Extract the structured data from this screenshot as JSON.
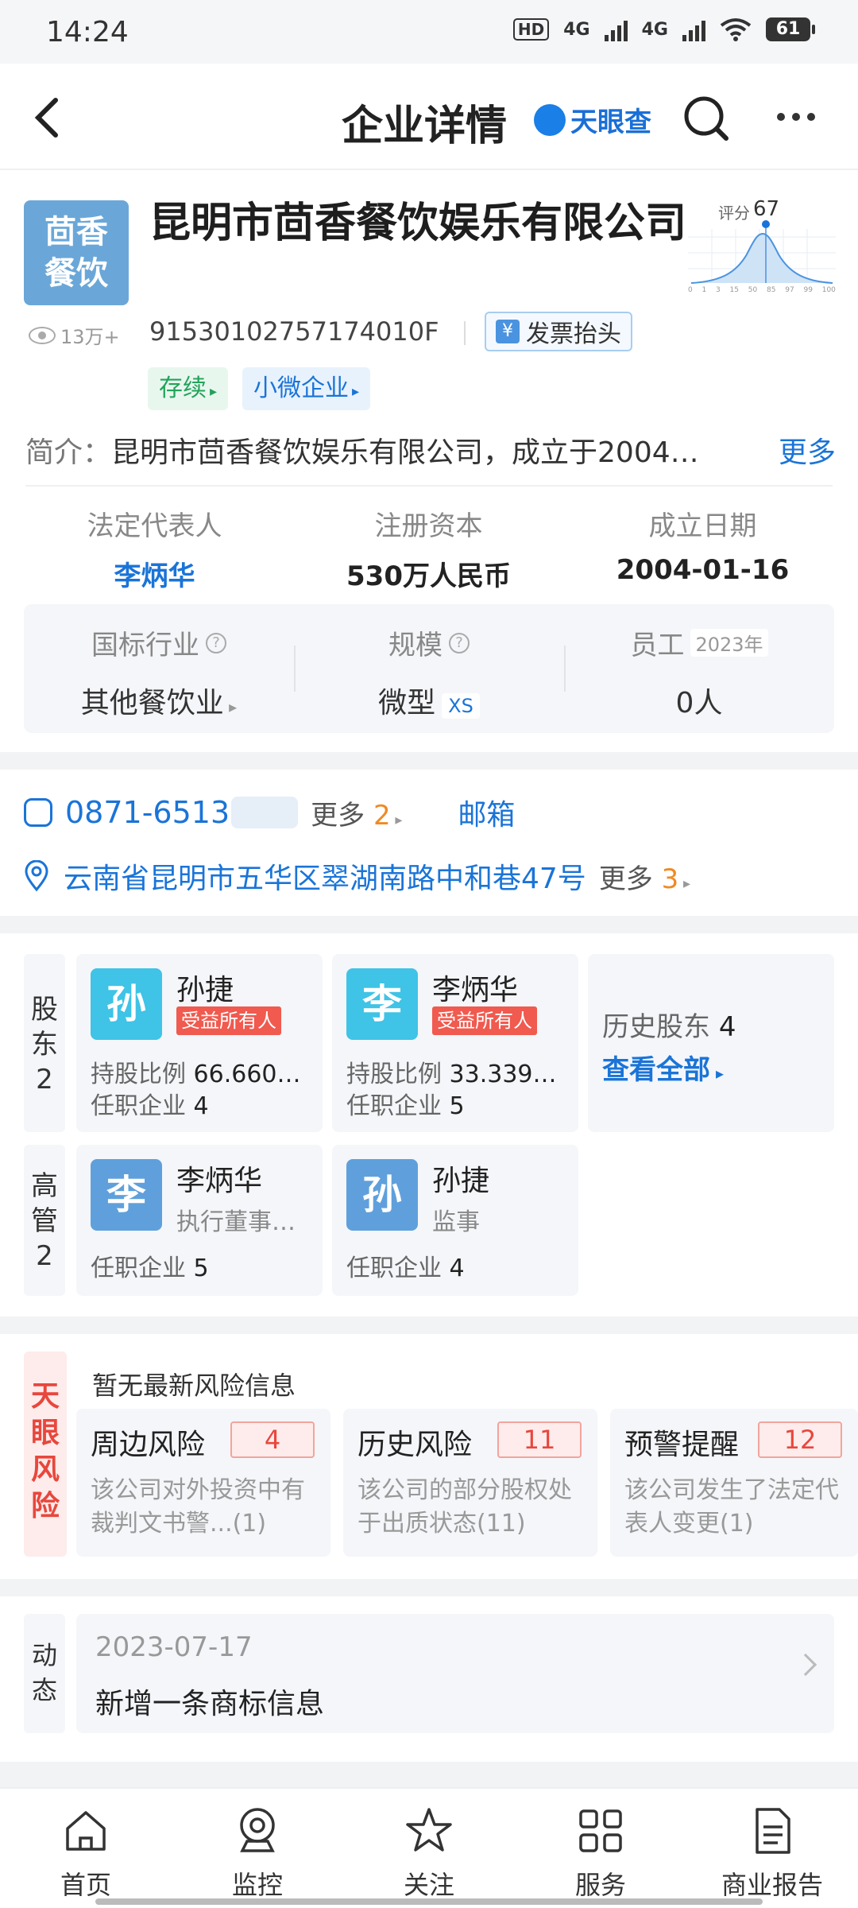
{
  "status_bar": {
    "time": "14:24",
    "hd": "HD",
    "net1": "4G",
    "net2": "4G",
    "battery": "61"
  },
  "nav": {
    "title": "企业详情",
    "brand": "天眼查"
  },
  "company": {
    "logo_line1": "茴香",
    "logo_line2": "餐饮",
    "name": "昆明市茴香餐饮娱乐有限公司",
    "score_label": "评分",
    "score_value": "67",
    "score_ticks": [
      "0",
      "1",
      "3",
      "15",
      "50",
      "85",
      "97",
      "99",
      "100"
    ],
    "views": "13万+",
    "credit_code": "91530102757174010F",
    "invoice_label": "发票抬头",
    "tags": [
      "存续",
      "小微企业"
    ],
    "intro_label": "简介：",
    "intro_text": "昆明市茴香餐饮娱乐有限公司，成立于2004…",
    "intro_more": "更多"
  },
  "key_info": [
    {
      "label": "法定代表人",
      "value": "李炳华"
    },
    {
      "label": "注册资本",
      "value": "530万人民币"
    },
    {
      "label": "成立日期",
      "value": "2004-01-16"
    }
  ],
  "industry_box": {
    "industry_label": "国标行业",
    "industry_value": "其他餐饮业",
    "scale_label": "规模",
    "scale_value": "微型",
    "scale_badge": "XS",
    "staff_label": "员工",
    "staff_year": "2023年",
    "staff_value": "0人"
  },
  "contact": {
    "phone": "0871-6513",
    "phone_more_label": "更多",
    "phone_more_count": "2",
    "email_label": "邮箱",
    "address": "云南省昆明市五华区翠湖南路中和巷47号",
    "address_more_label": "更多",
    "address_more_count": "3"
  },
  "shareholders": {
    "label_chars": [
      "股",
      "东",
      "2"
    ],
    "items": [
      {
        "avatar": "孙",
        "name": "孙捷",
        "badge": "受益所有人",
        "ratio_label": "持股比例",
        "ratio": "66.660…",
        "jobs_label": "任职企业",
        "jobs": "4"
      },
      {
        "avatar": "李",
        "name": "李炳华",
        "badge": "受益所有人",
        "ratio_label": "持股比例",
        "ratio": "33.339…",
        "jobs_label": "任职企业",
        "jobs": "5"
      }
    ],
    "history_label": "历史股东",
    "history_count": "4",
    "view_all": "查看全部"
  },
  "executives": {
    "label_chars": [
      "高",
      "管",
      "2"
    ],
    "items": [
      {
        "avatar": "李",
        "name": "李炳华",
        "role": "执行董事…",
        "jobs_label": "任职企业",
        "jobs": "5"
      },
      {
        "avatar": "孙",
        "name": "孙捷",
        "role": "监事",
        "jobs_label": "任职企业",
        "jobs": "4"
      }
    ]
  },
  "risk": {
    "label_chars": [
      "天",
      "眼",
      "风",
      "险"
    ],
    "none_text": "暂无最新风险信息",
    "items": [
      {
        "title": "周边风险",
        "count": "4",
        "desc": "该公司对外投资中有裁判文书警...(1)"
      },
      {
        "title": "历史风险",
        "count": "11",
        "desc": "该公司的部分股权处于出质状态(11)"
      },
      {
        "title": "预警提醒",
        "count": "12",
        "desc": "该公司发生了法定代表人变更(1)"
      }
    ]
  },
  "news": {
    "label_chars": [
      "动",
      "态"
    ],
    "date": "2023-07-17",
    "text": "新增一条商标信息"
  },
  "tabbar": [
    {
      "label": "首页",
      "icon": "home-icon"
    },
    {
      "label": "监控",
      "icon": "monitor-icon"
    },
    {
      "label": "关注",
      "icon": "star-icon"
    },
    {
      "label": "服务",
      "icon": "grid-icon"
    },
    {
      "label": "商业报告",
      "icon": "report-icon"
    }
  ],
  "colors": {
    "accent": "#1a74d8",
    "risk_red": "#e8473d",
    "orange": "#f08a24"
  }
}
